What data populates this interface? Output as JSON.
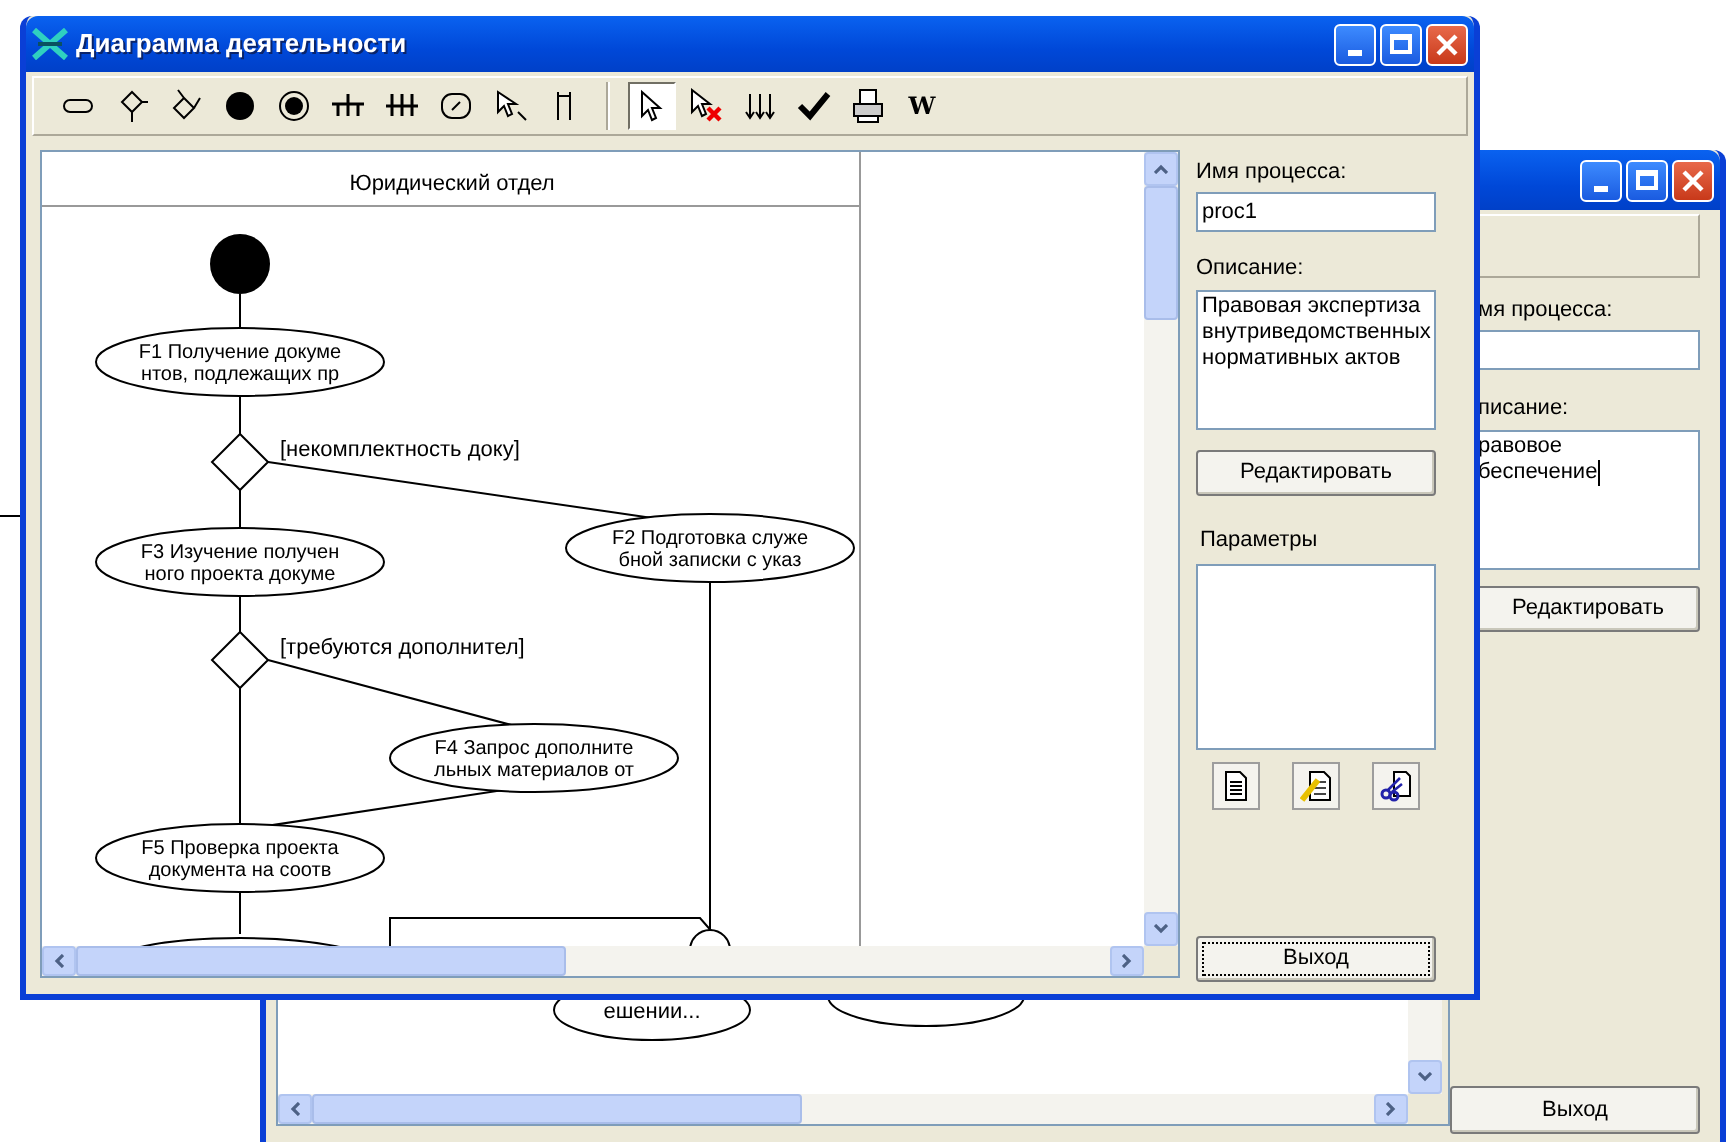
{
  "front_window": {
    "title": "Диаграмма деятельности",
    "toolbar": [
      {
        "kind": "action-state",
        "selected": false
      },
      {
        "kind": "decision",
        "selected": false
      },
      {
        "kind": "merge",
        "selected": false
      },
      {
        "kind": "initial",
        "selected": false
      },
      {
        "kind": "final",
        "selected": false
      },
      {
        "kind": "fork",
        "selected": false
      },
      {
        "kind": "join",
        "selected": false
      },
      {
        "kind": "object",
        "selected": false
      },
      {
        "kind": "transition",
        "selected": false
      },
      {
        "kind": "swimlane",
        "selected": false
      },
      {
        "kind": "separator"
      },
      {
        "kind": "pointer",
        "selected": true
      },
      {
        "kind": "delete",
        "selected": false
      },
      {
        "kind": "arrange",
        "selected": false
      },
      {
        "kind": "check",
        "selected": false
      },
      {
        "kind": "print",
        "selected": false
      },
      {
        "kind": "text",
        "label": "W",
        "selected": false
      }
    ],
    "lane": "Юридический отдел",
    "nodes": [
      {
        "kind": "start"
      },
      {
        "kind": "action",
        "lines": [
          "F1 Получение докуме",
          "нтов, подлежащих пр"
        ]
      },
      {
        "kind": "decision",
        "guard": "[некомплектность доку]"
      },
      {
        "kind": "action",
        "lines": [
          "F3 Изучение получен",
          "ного проекта докуме"
        ]
      },
      {
        "kind": "action",
        "lines": [
          "F2 Подготовка служе",
          "бной записки с указ"
        ]
      },
      {
        "kind": "decision",
        "guard": "[требуются дополнител]"
      },
      {
        "kind": "action",
        "lines": [
          "F4 Запрос дополните",
          "льных материалов от"
        ]
      },
      {
        "kind": "action",
        "lines": [
          "F5 Проверка проекта",
          "документа на соотв"
        ]
      }
    ],
    "panel": {
      "name_label": "Имя процесса:",
      "name_value": "proc1",
      "description_label": "Описание:",
      "description_value": "Правовая экспертиза внутриведомственных нормативных актов",
      "edit_button": "Редактировать",
      "params_label": "Параметры",
      "icon_buttons": [
        {
          "kind": "new"
        },
        {
          "kind": "edit"
        },
        {
          "kind": "cut"
        }
      ],
      "exit_button": "Выход"
    }
  },
  "back_window": {
    "name_label": "мя процесса:",
    "description_label": "писание:",
    "description_lines": [
      "равовое",
      "беспечение"
    ],
    "edit_button": "Редактировать",
    "exit_button": "Выход",
    "nodes": [
      "ешении..."
    ]
  }
}
